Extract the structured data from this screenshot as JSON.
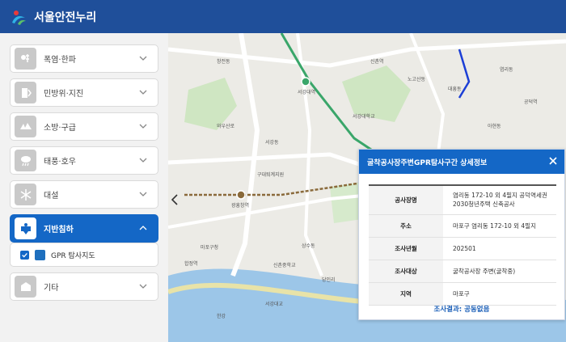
{
  "header": {
    "title": "서울안전누리"
  },
  "sidebar": {
    "items": [
      {
        "label": "폭염·한파",
        "icon": "heat-cold-icon"
      },
      {
        "label": "민방위·지진",
        "icon": "shelter-earthquake-icon"
      },
      {
        "label": "소방·구급",
        "icon": "fire-ambulance-icon"
      },
      {
        "label": "태풍·호우",
        "icon": "typhoon-rain-icon"
      },
      {
        "label": "대설",
        "icon": "snow-icon"
      },
      {
        "label": "지반침하",
        "icon": "ground-subsidence-icon"
      },
      {
        "label": "기타",
        "icon": "etc-icon"
      }
    ],
    "sub_item": {
      "label": "GPR 탐사지도",
      "checked": true
    }
  },
  "map": {
    "labels": [
      "서강대학교",
      "서강대역",
      "신촌역",
      "노고산동",
      "서강동",
      "대흥동",
      "창전동",
      "구대퇴계지원",
      "광흥창역",
      "상수동",
      "신촌중학교",
      "마포구청",
      "합정역",
      "한강",
      "당인리",
      "서강대교",
      "염리동",
      "아현동",
      "공덕역",
      "와우산로"
    ]
  },
  "panel": {
    "title": "굴착공사장주변GPR탐사구간 상세정보",
    "rows": [
      {
        "key": "공사장명",
        "value_lines": [
          "염리동 172-10 외 4필지 공덕역세권",
          "2030청년주택 신축공사"
        ]
      },
      {
        "key": "주소",
        "value_lines": [
          "마포구 염리동 172-10 외 4필지"
        ]
      },
      {
        "key": "조사년월",
        "value_lines": [
          "202501"
        ]
      },
      {
        "key": "조사대상",
        "value_lines": [
          "굴착공사장 주변(굴착중)"
        ]
      },
      {
        "key": "지역",
        "value_lines": [
          "마포구"
        ]
      }
    ],
    "result": "조사결과: 공동없음"
  },
  "colors": {
    "header": "#1f4f9a",
    "accent": "#1467c6",
    "map_road": "#ffffff",
    "map_green": "#cfe6c2",
    "map_river": "#9cc6e8",
    "subway_green": "#3aa66a",
    "subway_brown": "#8a6a3b"
  }
}
